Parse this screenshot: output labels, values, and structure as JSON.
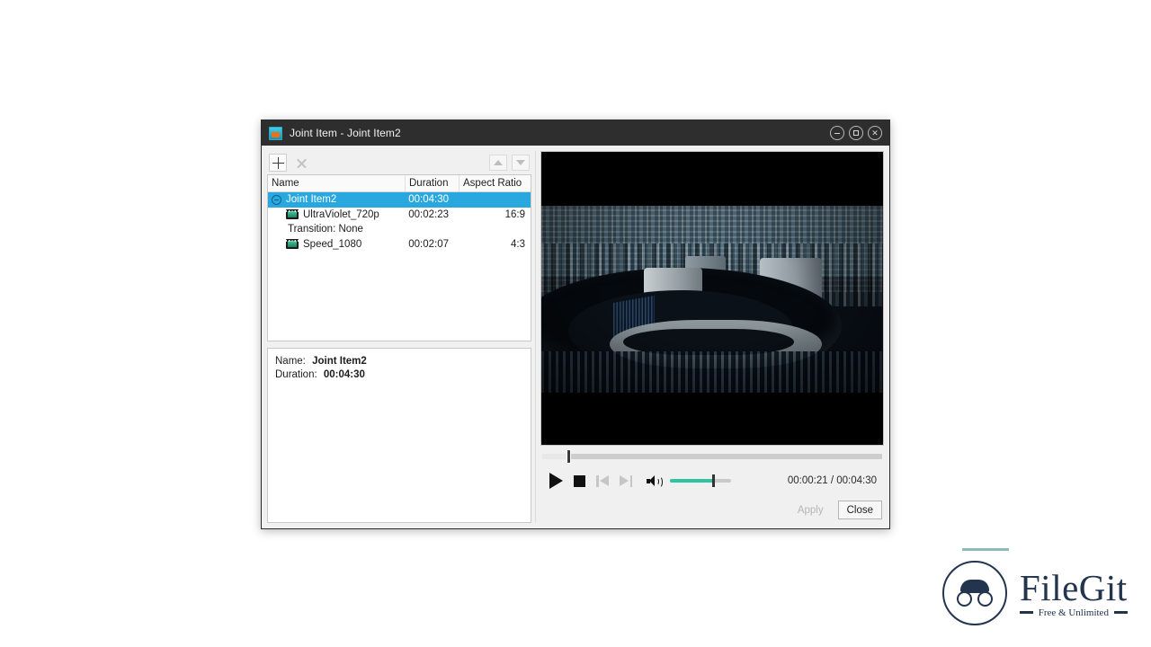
{
  "window": {
    "title": "Joint Item - Joint Item2",
    "app_icon": "film-app-icon",
    "controls": {
      "minimize": "minimize-icon",
      "maximize": "maximize-icon",
      "close": "close-icon"
    }
  },
  "toolbar": {
    "add_label": "+",
    "remove_label": "×",
    "move_up_label": "▲",
    "move_down_label": "▼"
  },
  "list": {
    "columns": [
      "Name",
      "Duration",
      "Aspect Ratio"
    ],
    "rows": [
      {
        "name": "Joint Item2",
        "duration": "00:04:30",
        "aspect_ratio": "",
        "type": "group",
        "selected": true,
        "indent": 0
      },
      {
        "name": "UltraViolet_720p",
        "duration": "00:02:23",
        "aspect_ratio": "16:9",
        "type": "clip",
        "selected": false,
        "indent": 1
      },
      {
        "name": "Transition: None",
        "duration": "",
        "aspect_ratio": "",
        "type": "transition",
        "selected": false,
        "indent": 1
      },
      {
        "name": "Speed_1080",
        "duration": "00:02:07",
        "aspect_ratio": "4:3",
        "type": "clip",
        "selected": false,
        "indent": 1
      }
    ]
  },
  "info": {
    "name_label": "Name:",
    "name_value": "Joint Item2",
    "duration_label": "Duration:",
    "duration_value": "00:04:30"
  },
  "player": {
    "seek_percent": 7.8,
    "volume_percent": 70,
    "time_current": "00:00:21",
    "time_total": "00:04:30",
    "time_display": "00:00:21 / 00:04:30",
    "buttons": {
      "play": "play-icon",
      "stop": "stop-icon",
      "previous": "previous-icon",
      "next": "next-icon",
      "volume": "volume-icon"
    },
    "volume_fill_color": "#2ec4a0"
  },
  "footer": {
    "apply_label": "Apply",
    "apply_enabled": false,
    "close_label": "Close",
    "close_enabled": true
  },
  "watermark": {
    "brand": "FileGit",
    "tagline": "Free & Unlimited"
  },
  "colors": {
    "selection": "#29a8e0",
    "titlebar": "#2e2e2e",
    "accent_green": "#2ec4a0"
  }
}
